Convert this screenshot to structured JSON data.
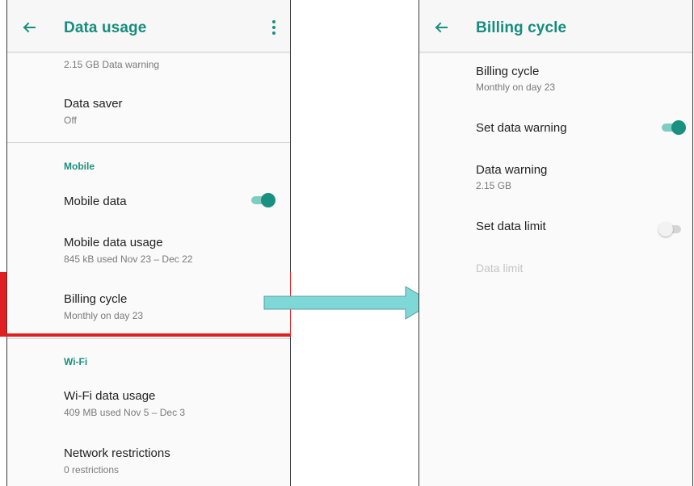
{
  "left_screen": {
    "title": "Data usage",
    "items": {
      "data_warning_summary": "2.15 GB Data warning",
      "data_saver": {
        "title": "Data saver",
        "summary": "Off"
      },
      "mobile_category": "Mobile",
      "mobile_data": {
        "title": "Mobile data",
        "enabled": true
      },
      "mobile_data_usage": {
        "title": "Mobile data usage",
        "summary": "845 kB used Nov 23 – Dec 22"
      },
      "billing_cycle": {
        "title": "Billing cycle",
        "summary": "Monthly on day 23"
      },
      "wifi_category": "Wi-Fi",
      "wifi_data_usage": {
        "title": "Wi-Fi data usage",
        "summary": "409 MB used Nov 5 – Dec 3"
      },
      "network_restrictions": {
        "title": "Network restrictions",
        "summary": "0 restrictions"
      }
    }
  },
  "right_screen": {
    "title": "Billing cycle",
    "items": {
      "billing_cycle": {
        "title": "Billing cycle",
        "summary": "Monthly on day 23"
      },
      "set_data_warning": {
        "title": "Set data warning",
        "enabled": true
      },
      "data_warning": {
        "title": "Data warning",
        "summary": "2.15 GB"
      },
      "set_data_limit": {
        "title": "Set data limit",
        "enabled": false
      },
      "data_limit": {
        "title": "Data limit",
        "disabled": true
      }
    }
  },
  "icons": {
    "back": "arrow-back-icon",
    "overflow": "more-vert-icon"
  },
  "colors": {
    "accent": "#1a9080",
    "toggle_track_on": "#7fcdc1",
    "highlight": "#e02020",
    "arrow_fill": "#7fd8d8"
  }
}
